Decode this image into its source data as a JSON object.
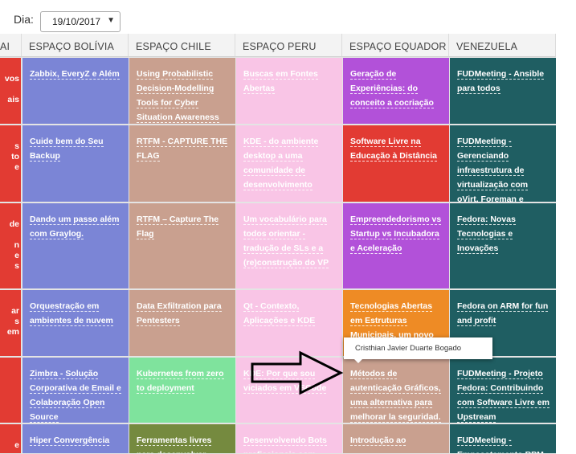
{
  "filter": {
    "day_label": "Dia:",
    "date_value": "19/10/2017"
  },
  "columns": [
    {
      "label": "AI"
    },
    {
      "label": "ESPAÇO BOLÍVIA"
    },
    {
      "label": "ESPAÇO CHILE"
    },
    {
      "label": "ESPAÇO PERU"
    },
    {
      "label": "ESPAÇO EQUADOR"
    },
    {
      "label": "VENEZUELA"
    }
  ],
  "first_column_fragments": [
    [
      "vos",
      "",
      "ais"
    ],
    [
      "s",
      "to",
      "e"
    ],
    [
      "de",
      "",
      "n",
      "e",
      "s"
    ],
    [
      "ar",
      "s",
      "em"
    ],
    [],
    [
      "e",
      "-"
    ]
  ],
  "rows": [
    {
      "cells": [
        {
          "text": "Zabbix, EveryZ e Além",
          "color": "#7b85d6"
        },
        {
          "text": "Using Probabilistic Decision-Modelling Tools for Cyber Situation Awareness",
          "color": "#c9a08f"
        },
        {
          "text": "Buscas em Fontes Abertas",
          "color": "#f9c5e6"
        },
        {
          "text": "Geração de Experiências: do conceito a cocriação",
          "color": "#b251d9"
        },
        {
          "text": "FUDMeeting - Ansible para todos",
          "color": "#1f5e62"
        }
      ]
    },
    {
      "cells": [
        {
          "text": "Cuide bem do Seu Backup",
          "color": "#7b85d6"
        },
        {
          "text": "RTFM - CAPTURE THE FLAG",
          "color": "#c9a08f"
        },
        {
          "text": "KDE - do ambiente desktop a uma comunidade de desenvolvimento",
          "color": "#f9c5e6"
        },
        {
          "text": "Software Livre na Educação à Distância",
          "color": "#e23b33"
        },
        {
          "text": "FUDMeeting - Gerenciando infraestrutura de virtualização com oVirt, Foreman e Ansible",
          "color": "#1f5e62"
        }
      ]
    },
    {
      "cells": [
        {
          "text": "Dando um passo além com Graylog.",
          "color": "#7b85d6"
        },
        {
          "text": "RTFM – Capture The Flag",
          "color": "#c9a08f"
        },
        {
          "text": "Um vocabulário para todos orientar - tradução de SLs e a (re)construção do VP",
          "color": "#f9c5e6"
        },
        {
          "text": "Empreendedorismo vs Startup vs Incubadora e Aceleração",
          "color": "#b251d9"
        },
        {
          "text": "Fedora: Novas Tecnologias e Inovações",
          "color": "#1f5e62"
        }
      ]
    },
    {
      "cells": [
        {
          "text": "Orquestração em ambientes de nuvem",
          "color": "#7b85d6"
        },
        {
          "text": "Data Exfiltration para Pentesters",
          "color": "#c9a08f"
        },
        {
          "text": "Qt - Contexto, Aplicações e KDE",
          "color": "#f9c5e6"
        },
        {
          "text": "Tecnologias Abertas em Estruturas Municipais, um novo momento em",
          "color": "#ee8b25"
        },
        {
          "text": "Fedora on ARM for fun and profit",
          "color": "#1f5e62"
        }
      ]
    },
    {
      "cells": [
        {
          "text": "Zimbra - Solução Corporativa de Email e Colaboração Open Source",
          "color": "#7b85d6"
        },
        {
          "text": "Kubernetes from zero to deployment",
          "color": "#7fe39d"
        },
        {
          "text": "KDE: Por que sou viciados em VSCode",
          "color": "#f9c5e6"
        },
        {
          "text": "Métodos de autenticação Gráficos, uma alternativa para melhorar la seguridad.",
          "color": "#c9a08f"
        },
        {
          "text": "FUDMeeting - Projeto Fedora: Contribuindo com Software Livre em Upstream",
          "color": "#1f5e62"
        }
      ]
    },
    {
      "cells": [
        {
          "text": "Hiper Convergência",
          "color": "#7b85d6"
        },
        {
          "text": "Ferramentas livres para desenvolver",
          "color": "#758a3f"
        },
        {
          "text": "Desenvolvendo Bots profissionais com",
          "color": "#f9c5e6"
        },
        {
          "text": "Introdução ao",
          "color": "#c9a08f"
        },
        {
          "text": "FUDMeeting - Empacotamento RPM",
          "color": "#1f5e62"
        }
      ]
    }
  ],
  "tooltip": {
    "text": "Cristhian Javier Duarte Bogado"
  },
  "colors": {
    "first_column": "#e23b33",
    "header_bg": "#f3f3f3"
  }
}
